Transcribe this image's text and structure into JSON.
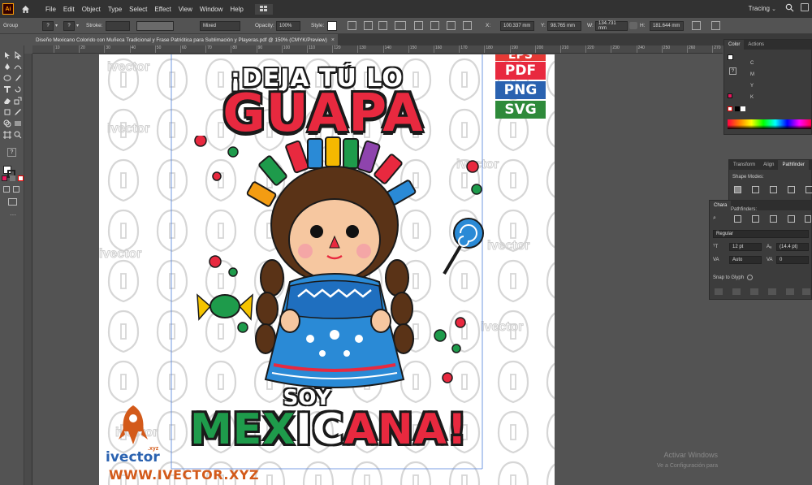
{
  "app": {
    "logo": "Ai"
  },
  "menu": [
    "File",
    "Edit",
    "Object",
    "Type",
    "Select",
    "Effect",
    "View",
    "Window",
    "Help"
  ],
  "workspace": {
    "label": "Tracing"
  },
  "control_bar": {
    "selection": "Group",
    "stroke_label": "Stroke:",
    "mixed_value": "Mixed",
    "opacity_label": "Opacity:",
    "opacity_value": "100%",
    "style_label": "Style:",
    "x_label": "X:",
    "x_value": "100.337 mm",
    "y_label": "Y:",
    "y_value": "98.765 mm",
    "w_label": "W:",
    "w_value": "134.731 mm",
    "h_label": "H:",
    "h_value": "181.644 mm"
  },
  "document": {
    "tab_title": "Diseño Mexicano Colorido con Muñeca Tradicional y Frase Patriótica para Sublimación y Playeras.pdf @ 150% (CMYK/Preview)",
    "close": "×"
  },
  "ruler_ticks": [
    "10",
    "20",
    "30",
    "40",
    "50",
    "60",
    "70",
    "80",
    "90",
    "100",
    "110",
    "120",
    "130",
    "140",
    "150",
    "160",
    "170",
    "180",
    "190",
    "200",
    "210",
    "220",
    "230",
    "240",
    "250",
    "260",
    "270"
  ],
  "artwork": {
    "line1": "¡DEJA TÚ LO",
    "line2": "GUAPA",
    "line3": "SOY",
    "line4a": "MEX",
    "line4b": "IC",
    "line4c": "ANA!",
    "formats": [
      "EPS",
      "PDF",
      "PNG",
      "SVG"
    ],
    "format_colors": [
      "#e53935",
      "#e8293f",
      "#2a62b0",
      "#2e8a3a"
    ],
    "brand": "ivector",
    "brand_suffix": ".xyz",
    "url": "WWW.IVECTOR.XYZ",
    "watermark_text": "ivector"
  },
  "panels": {
    "color": {
      "tabs": [
        "Color",
        "Actions"
      ],
      "channels": [
        "C",
        "M",
        "Y",
        "K"
      ]
    },
    "transform": {
      "tabs": [
        "Transform",
        "Align",
        "Pathfinder"
      ],
      "shape_modes": "Shape Modes:",
      "pathfinders": "Pathfinders:"
    },
    "character": {
      "tab": "Chara",
      "font_style": "Regular",
      "size": "12 pt",
      "leading": "(14.4 pt)",
      "kerning": "Auto",
      "tracking": "0",
      "snap": "Snap to Glyph"
    }
  },
  "windows_watermark": {
    "line1": "Activar Windows",
    "line2": "Ve a Configuración para"
  },
  "colors": {
    "brand_red": "#e8293f",
    "brand_green": "#1e9b4b",
    "accent_orange": "#d35a1a",
    "fill_swatch": "#e8175d"
  }
}
